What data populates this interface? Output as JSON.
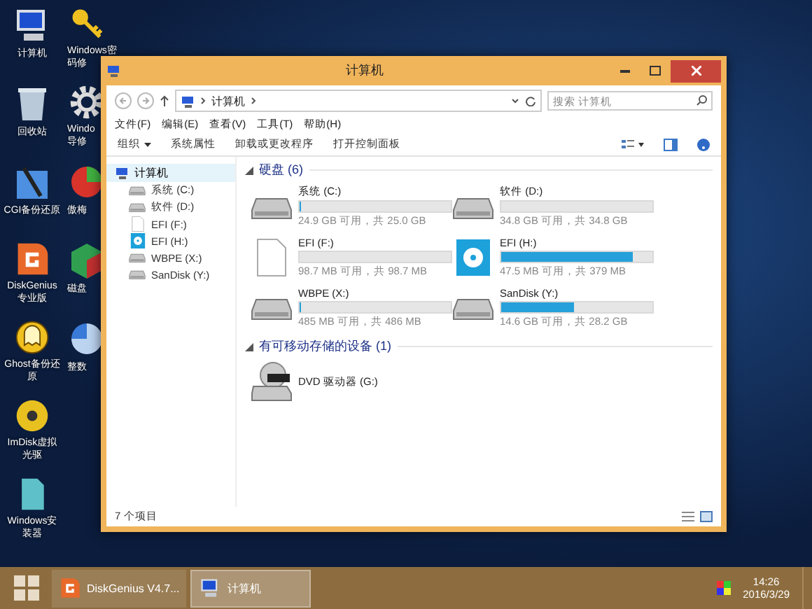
{
  "desktop_icons": [
    {
      "kind": "computer",
      "lines": [
        "计算机"
      ]
    },
    {
      "kind": "recycle",
      "lines": [
        "回收站"
      ]
    },
    {
      "kind": "backup",
      "lines": [
        "CGI备份还原"
      ]
    },
    {
      "kind": "diskgenius",
      "lines": [
        "DiskGenius",
        "专业版"
      ]
    },
    {
      "kind": "ghost",
      "lines": [
        "Ghost备份还",
        "原"
      ]
    },
    {
      "kind": "disc",
      "lines": [
        "ImDisk虚拟",
        "光驱"
      ]
    },
    {
      "kind": "installer",
      "lines": [
        "Windows安",
        "装器"
      ]
    }
  ],
  "desktop_icons_col2": [
    {
      "kind": "key",
      "lines": [
        "Windows密",
        "码修"
      ]
    },
    {
      "kind": "gear",
      "lines": [
        "Windo",
        "导修"
      ]
    },
    {
      "kind": "partition",
      "lines": [
        "傲梅"
      ]
    },
    {
      "kind": "defrag",
      "lines": [
        "磁盘"
      ]
    },
    {
      "kind": "pie",
      "lines": [
        "整数"
      ]
    }
  ],
  "window": {
    "title": "计算机",
    "address": {
      "crumbs": [
        "计算机"
      ],
      "search_placeholder": "搜索 计算机"
    },
    "menu": [
      "文件(F)",
      "编辑(E)",
      "查看(V)",
      "工具(T)",
      "帮助(H)"
    ],
    "commands": [
      {
        "label": "组织",
        "dropdown": true
      },
      {
        "label": "系统属性",
        "dropdown": false
      },
      {
        "label": "卸载或更改程序",
        "dropdown": false
      },
      {
        "label": "打开控制面板",
        "dropdown": false
      }
    ],
    "nav": {
      "label": "计算机",
      "selected": true,
      "children": [
        {
          "label": "系统 (C:)",
          "kind": "hdd"
        },
        {
          "label": "软件 (D:)",
          "kind": "hdd"
        },
        {
          "label": "EFI (F:)",
          "kind": "file"
        },
        {
          "label": "EFI (H:)",
          "kind": "usb"
        },
        {
          "label": "WBPE (X:)",
          "kind": "hdd"
        },
        {
          "label": "SanDisk (Y:)",
          "kind": "hdd"
        }
      ]
    },
    "groups": [
      {
        "title": "硬盘 (6)",
        "expanded": true,
        "drives": [
          {
            "name": "系统 (C:)",
            "kind": "hdd",
            "level": 0.004,
            "free": "24.9 GB 可用，共 25.0 GB"
          },
          {
            "name": "软件 (D:)",
            "kind": "hdd",
            "level": 0.0,
            "free": "34.8 GB 可用，共 34.8 GB"
          },
          {
            "name": "EFI (F:)",
            "kind": "file",
            "level": 0.0,
            "free": "98.7 MB 可用，共 98.7 MB"
          },
          {
            "name": "EFI (H:)",
            "kind": "usb",
            "level": 0.87,
            "free": "47.5 MB 可用，共 379 MB"
          },
          {
            "name": "WBPE (X:)",
            "kind": "hdd",
            "level": 0.003,
            "free": "485 MB 可用，共 486 MB"
          },
          {
            "name": "SanDisk (Y:)",
            "kind": "hdd",
            "level": 0.48,
            "free": "14.6 GB 可用，共 28.2 GB"
          }
        ]
      },
      {
        "title": "有可移动存储的设备 (1)",
        "expanded": true,
        "drives": [
          {
            "name": "DVD 驱动器 (G:)",
            "kind": "dvd"
          }
        ]
      }
    ],
    "status": "7 个项目"
  },
  "taskbar": {
    "tasks": [
      {
        "label": "DiskGenius V4.7...",
        "kind": "diskgenius",
        "selected": false
      },
      {
        "label": "计算机",
        "kind": "computer",
        "selected": true
      }
    ],
    "time": "14:26",
    "date": "2016/3/29"
  }
}
